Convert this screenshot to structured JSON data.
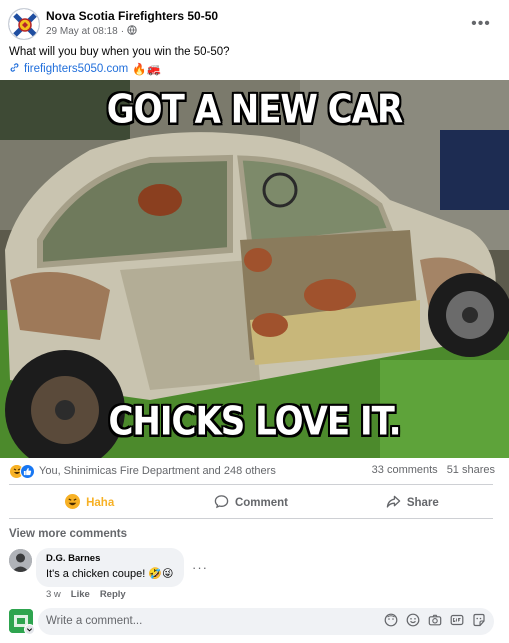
{
  "post": {
    "page_name": "Nova Scotia Firefighters 50-50",
    "timestamp": "29 May at 08:18",
    "audience_icon": "globe-icon",
    "more_icon": "more-horizontal-icon",
    "caption": "What will you buy when you win the 50-50?",
    "link_text": "firefighters5050.com",
    "link_emojis": "🔥🚒"
  },
  "image": {
    "top_text": "GOT A NEW CAR",
    "bottom_text": "CHICKS LOVE IT."
  },
  "reactions": {
    "icons": [
      "haha-reaction",
      "like-reaction"
    ],
    "summary": "You, Shinimicas Fire Department and 248 others",
    "comments_count": "33 comments",
    "shares_count": "51 shares"
  },
  "actions": {
    "haha_label": "Haha",
    "comment_label": "Comment",
    "share_label": "Share"
  },
  "comments": {
    "view_more": "View more comments",
    "items": [
      {
        "author": "D.G. Barnes",
        "text": "It's a chicken coupe!",
        "emojis": "🤣😜",
        "age": "3 w",
        "like_label": "Like",
        "reply_label": "Reply"
      }
    ]
  },
  "composer": {
    "placeholder": "Write a comment...",
    "icons": [
      "avatar-sticker-icon",
      "emoji-icon",
      "camera-icon",
      "gif-icon",
      "sticker-icon"
    ]
  },
  "colors": {
    "link": "#216fdb",
    "haha": "#f7b125",
    "like": "#1877f2",
    "secondary_text": "#65676b",
    "bubble": "#f0f2f5"
  }
}
